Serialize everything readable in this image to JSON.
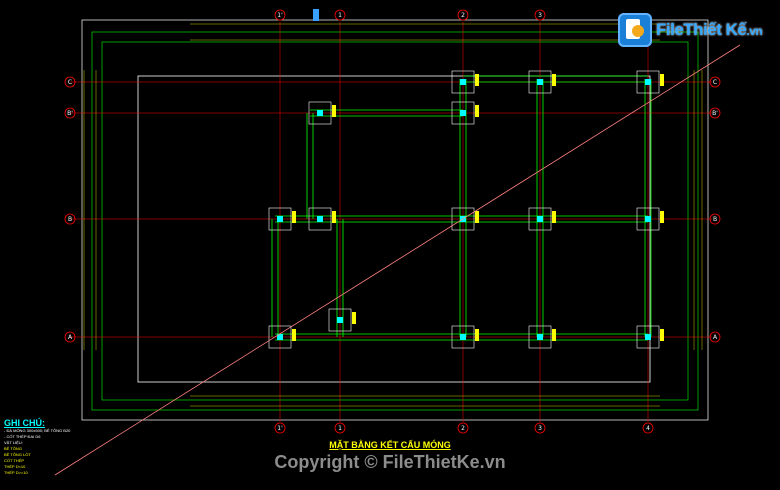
{
  "grid": {
    "top_bubbles": [
      "1'",
      "1",
      "2",
      "3"
    ],
    "bottom_bubbles": [
      "1'",
      "1",
      "2",
      "3",
      "4"
    ],
    "left_bubbles": [
      "C",
      "B'",
      "B",
      "A"
    ],
    "right_bubbles": [
      "C",
      "B'",
      "B",
      "A"
    ]
  },
  "logo": {
    "brand": "File",
    "name": "Thiết Kế",
    "domain": ".vn",
    "icon": "file-logo-icon"
  },
  "notes": {
    "title": "GHI CHÚ:",
    "lines": [
      "- ĐÀ MÓNG 300x500; BÊ TÔNG B20",
      "- CỐT THÉP ĐAI D6",
      "VẬT LIỆU:",
      "BÊ TÔNG",
      "BÊ TÔNG LÓT",
      "CỐT THÉP",
      "THÉP D<10",
      "THÉP D>=10"
    ]
  },
  "drawing_title": "MẶT BẰNG KẾT CẤU MÓNG",
  "copyright": "Copyright © FileThietKe.vn",
  "colors": {
    "background": "#000000",
    "frame": "#ffffff",
    "beam": "#00ff00",
    "grid": "#ff0000",
    "dimension": "#ffff00",
    "bubble": "#ff0000",
    "pad": "#00ffff",
    "diagonal": "#ff7f7f"
  }
}
